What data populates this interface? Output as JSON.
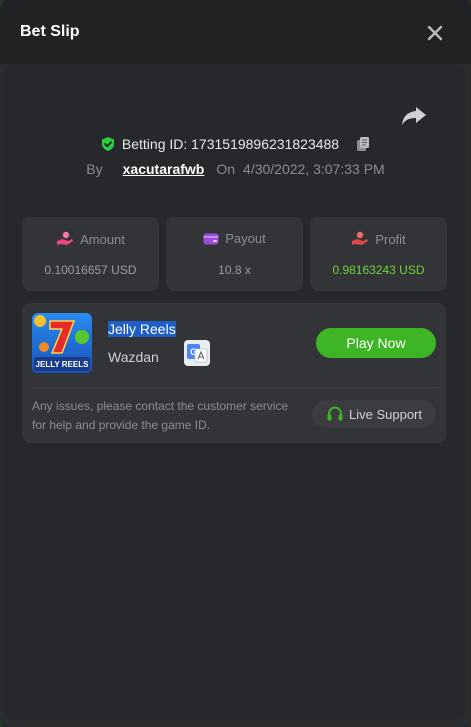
{
  "header": {
    "title": "Bet Slip"
  },
  "bet": {
    "id_text": "Betting ID: 1731519896231823488",
    "by_label": "By",
    "username": "xacutarafwb",
    "on_label": "On",
    "datetime": "4/30/2022, 3:07:33 PM"
  },
  "stats": [
    {
      "label": "Amount",
      "value": "0.10016657 USD",
      "icon": "hand-coins-icon",
      "icon_color": "#e8497a"
    },
    {
      "label": "Payout",
      "value": "10.8 x",
      "icon": "wallet-icon",
      "icon_color": "#9b4dd6"
    },
    {
      "label": "Profit",
      "value": "0.98163243 USD",
      "icon": "hand-money-icon",
      "icon_color": "#e04848"
    }
  ],
  "game": {
    "name": "Jelly Reels",
    "provider": "Wazdan",
    "thumb_caption": "JELLY REELS",
    "play_label": "Play Now",
    "issue_text": "Any issues, please contact the customer service for help and provide the game ID.",
    "support_label": "Live Support"
  },
  "colors": {
    "accent_green": "#3eb524",
    "profit_green": "#6fd23a",
    "shield_green": "#2ecc40"
  }
}
